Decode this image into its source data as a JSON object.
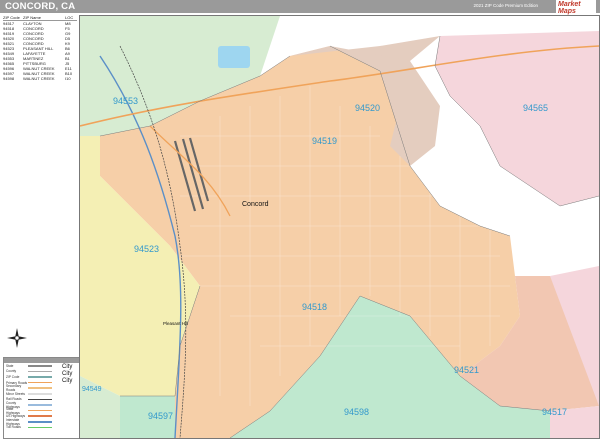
{
  "header": {
    "title": "CONCORD, CA",
    "edition": "2021 ZIP Code Premium Edition",
    "logo_text": "Market Maps"
  },
  "zip_table": {
    "headers": [
      "ZIP Code",
      "ZIP Name",
      "LOC"
    ],
    "rows": [
      [
        "94517",
        "CLAYTON",
        "M8"
      ],
      [
        "94518",
        "CONCORD",
        "F5"
      ],
      [
        "94519",
        "CONCORD",
        "G9"
      ],
      [
        "94520",
        "CONCORD",
        "D5"
      ],
      [
        "94521",
        "CONCORD",
        "K9"
      ],
      [
        "94523",
        "PLEASANT HILL",
        "B6"
      ],
      [
        "94549",
        "LAFAYETTE",
        "A9"
      ],
      [
        "94553",
        "MARTINEZ",
        "B1"
      ],
      [
        "94565",
        "PITTSBURG",
        "J5"
      ],
      [
        "94596",
        "WALNUT CREEK",
        "E11"
      ],
      [
        "94597",
        "WALNUT CREEK",
        "B10"
      ],
      [
        "94598",
        "WALNUT CREEK",
        "I10"
      ]
    ]
  },
  "map": {
    "zip_labels": [
      "94553",
      "94520",
      "94565",
      "94519",
      "94523",
      "94518",
      "94521",
      "94597",
      "94598",
      "94517",
      "94549"
    ],
    "city_labels": [
      "Concord",
      "Pleasant Hill"
    ],
    "colors": {
      "pleasant_hill": "#f4efb4",
      "concord_core": "#f6cfa8",
      "concord_east": "#f2c7b2",
      "north_mauve": "#e4cdbf",
      "pittsburg": "#f5d6dc",
      "martinez": "#d7ecd2",
      "walnut_creek": "#bfe8cf",
      "water": "#9ed6f0",
      "zip_label": "#3399cc"
    }
  },
  "legend": {
    "rows": [
      "State",
      "County",
      "ZIP Code",
      "Primary Roads",
      "Secondary Roads",
      "Minor Streets",
      "Rail Roads",
      "County Highways",
      "State Highways",
      "US Highways",
      "Interstate Highways",
      "Toll Roads"
    ],
    "city_samples": [
      "City",
      "City",
      "City"
    ]
  }
}
